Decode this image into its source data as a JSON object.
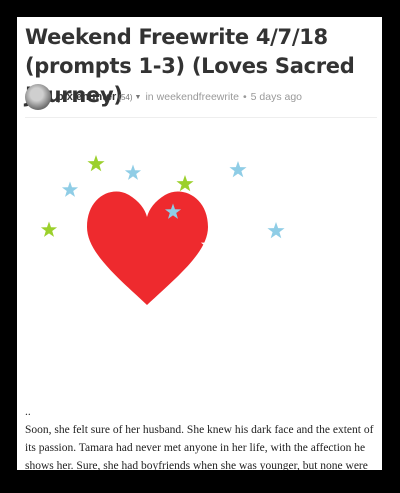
{
  "post": {
    "title": "Weekend Freewrite 4/7/18 (prompts 1-3) (Loves Sacred Journey)",
    "author": "pixiehunter",
    "reputation": "(54)",
    "in_label": "in",
    "community": "weekendfreewrite",
    "separator": "•",
    "time_ago": "5 days ago"
  },
  "illustration": {
    "heart_color": "#ee2a2e",
    "star_colors": {
      "blue": "#8fcde6",
      "green": "#9bd02b",
      "white": "#ffffff"
    }
  },
  "body": {
    "marker": "..",
    "paragraph": "Soon, she felt sure of her husband. She knew his dark face and the extent of its passion. Tamara had never met anyone in her life, with the affection he shows her. Sure, she had boyfriends when she was younger, but none were truly her soul-mate. James had a tender but"
  },
  "icons": {
    "author_menu": "chevron-down-icon"
  }
}
